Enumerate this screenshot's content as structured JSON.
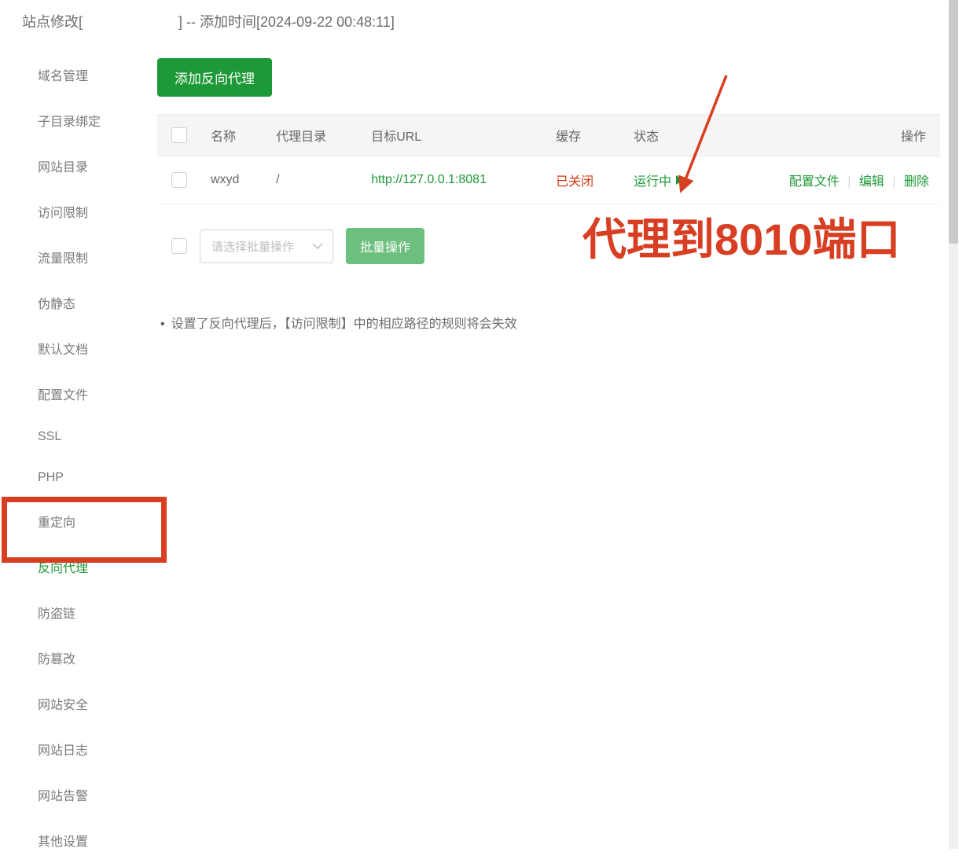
{
  "header": {
    "title_left": "站点修改[",
    "title_right": "] -- 添加时间[2024-09-22 00:48:11]"
  },
  "sidebar": {
    "items": [
      "域名管理",
      "子目录绑定",
      "网站目录",
      "访问限制",
      "流量限制",
      "伪静态",
      "默认文档",
      "配置文件",
      "SSL",
      "PHP",
      "重定向",
      "反向代理",
      "防盗链",
      "防篡改",
      "网站安全",
      "网站日志",
      "网站告警",
      "其他设置"
    ],
    "active_index": 11
  },
  "buttons": {
    "add_proxy": "添加反向代理",
    "batch": "批量操作"
  },
  "table": {
    "headers": {
      "name": "名称",
      "dir": "代理目录",
      "url": "目标URL",
      "cache": "缓存",
      "status": "状态",
      "ops": "操作"
    },
    "row": {
      "name": "wxyd",
      "dir": "/",
      "url": "http://127.0.0.1:8081",
      "cache": "已关闭",
      "status": "运行中",
      "ops": {
        "config": "配置文件",
        "edit": "编辑",
        "delete": "删除"
      }
    }
  },
  "batch_select_placeholder": "请选择批量操作",
  "note": "设置了反向代理后，【访问限制】中的相应路径的规则将会失效",
  "annotation": "代理到8010端口"
}
